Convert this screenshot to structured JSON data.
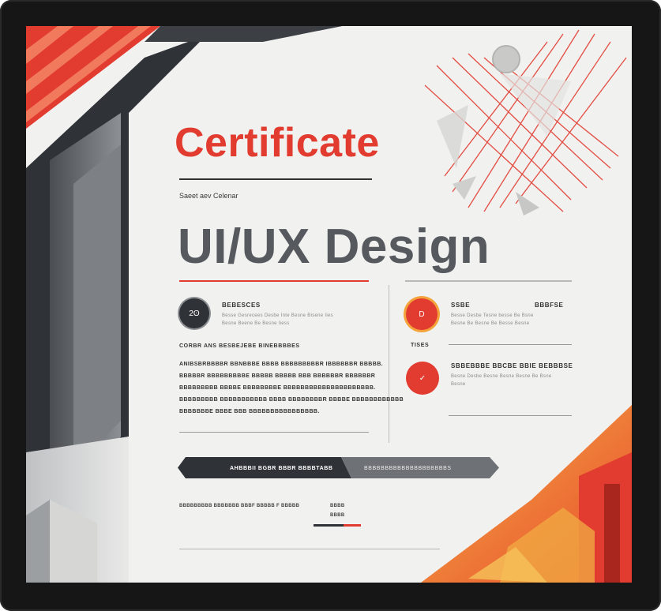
{
  "certificate": {
    "title": "Certificate",
    "small_heading": "Saeet aev Celenar",
    "course": "UI/UX Design"
  },
  "left_section": {
    "badge_glyph": "2ʘ",
    "heading": "BEBESCES",
    "detail_1": "Besse Gesrecees   Desbe   Inte   Besne Bisene Iies",
    "detail_2": "Besne Beene Be Besne Iiess",
    "subheading": "CORBR ANS BESBEJEBE BINEBBBBES",
    "paragraph": [
      "ANIBSBRBBBBR BBNBBBE BBBB BBBBBBBBBR IBBBBBBR BBBBB.",
      "BBBBBR BBBBBBBBBE BBBBB BBBBB BBB BBBBBBR BBBBBBR",
      "BBBBBBBBB BBBBE BBBBBBBBE BBBBBBBBBBBBBBBBBBBBB.",
      "BBBBBBBBB BBBBBBBBBBB BBBB BBBBBBBBR BBBBE BBBBBBBBBBBB",
      "BBBBBBBE BBBE BBB BBBBBBBBBBBBBBBB."
    ]
  },
  "right_section": {
    "top_label_left": "SSBE",
    "top_label_right": "BBBFSE",
    "top_detail_1": "Besse Desbe Tesne besse   Be Bsne",
    "top_detail_2": "Besne Be Besne Be Besse Besne",
    "mid_label": "TISES",
    "bottom_label": "SBBEBBBE BBCBE BBIE BEBBBSE",
    "bottom_detail_1": "Besne Desbe Besne Besne Besne Be Bsne",
    "bottom_detail_2": "Besne",
    "badge1_glyph": "D",
    "badge2_glyph": "✓"
  },
  "ribbon": {
    "left_text": "AHBBBII BGBR BBBR BBBBTABB",
    "right_text": "BBBBBBBBBBBBBBBBBBBBS"
  },
  "footer": {
    "left_text": "BBBBBBBBB BBBBBBB BBBF BBBBB F BBBBB",
    "right_top": "BBBB",
    "right_bottom": "BBBB"
  },
  "colors": {
    "accent_red": "#e23b2f",
    "accent_orange": "#ee7a2a",
    "dark_gray": "#2f3338",
    "mid_gray": "#6e7175"
  }
}
